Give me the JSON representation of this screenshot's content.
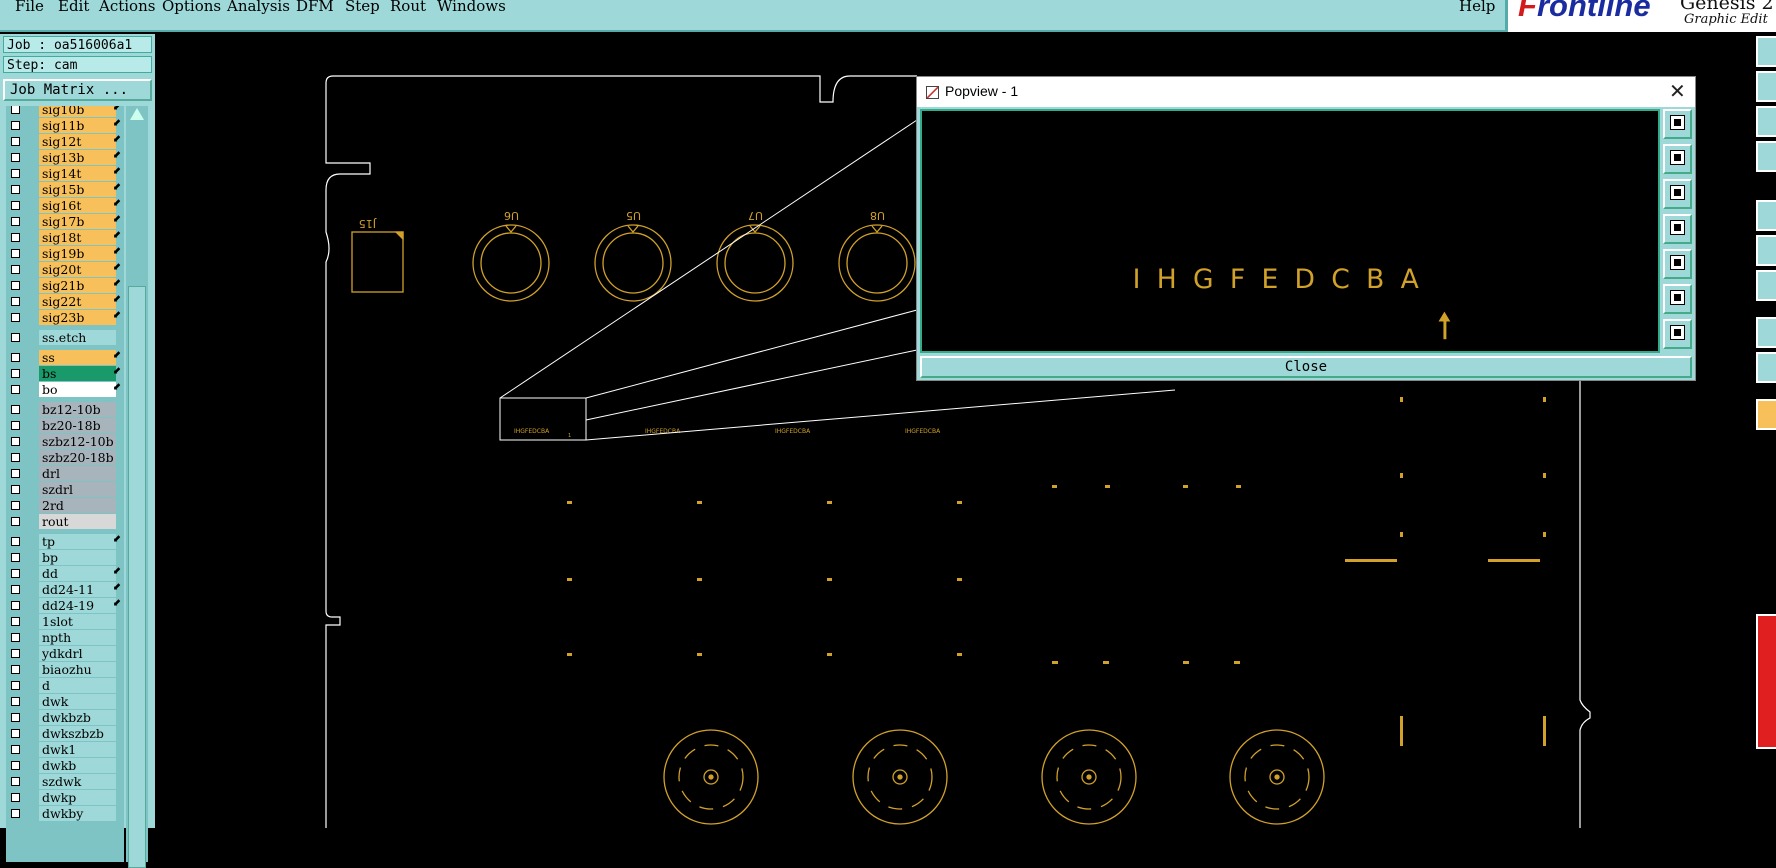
{
  "menubar": {
    "items": [
      "File",
      "Edit",
      "Actions",
      "Options",
      "Analysis",
      "DFM",
      "Step",
      "Rout",
      "Windows"
    ],
    "help": "Help"
  },
  "brand": {
    "logo_prefix": "F",
    "logo_rest": "rontline",
    "product": "Genesis 2",
    "subtitle": "Graphic Edit"
  },
  "job": {
    "job_label": "Job : oa516006a1",
    "step_label": "Step: cam",
    "matrix_button": "Job Matrix ..."
  },
  "layers": [
    {
      "name": "sig10b",
      "color": "#f8c05a",
      "flag": true
    },
    {
      "name": "sig11b",
      "color": "#f8c05a",
      "flag": true
    },
    {
      "name": "sig12t",
      "color": "#f8c05a",
      "flag": true
    },
    {
      "name": "sig13b",
      "color": "#f8c05a",
      "flag": true
    },
    {
      "name": "sig14t",
      "color": "#f8c05a",
      "flag": true
    },
    {
      "name": "sig15b",
      "color": "#f8c05a",
      "flag": true
    },
    {
      "name": "sig16t",
      "color": "#f8c05a",
      "flag": true
    },
    {
      "name": "sig17b",
      "color": "#f8c05a",
      "flag": true
    },
    {
      "name": "sig18t",
      "color": "#f8c05a",
      "flag": true
    },
    {
      "name": "sig19b",
      "color": "#f8c05a",
      "flag": true
    },
    {
      "name": "sig20t",
      "color": "#f8c05a",
      "flag": true
    },
    {
      "name": "sig21b",
      "color": "#f8c05a",
      "flag": true
    },
    {
      "name": "sig22t",
      "color": "#f8c05a",
      "flag": true
    },
    {
      "name": "sig23b",
      "color": "#f8c05a",
      "flag": true
    },
    {
      "name": "ss.etch",
      "color": "#9ed8d8",
      "flag": false,
      "gap": true
    },
    {
      "name": "ss",
      "color": "#f8c05a",
      "flag": true,
      "gap": true
    },
    {
      "name": "bs",
      "color": "#1a9a6a",
      "flag": true
    },
    {
      "name": "bo",
      "color": "#ffffff",
      "flag": true
    },
    {
      "name": "bz12-10b",
      "color": "#a8b4bc",
      "flag": false,
      "gap": true
    },
    {
      "name": "bz20-18b",
      "color": "#a8b4bc",
      "flag": false
    },
    {
      "name": "szbz12-10b",
      "color": "#a8b4bc",
      "flag": false
    },
    {
      "name": "szbz20-18b",
      "color": "#a8b4bc",
      "flag": false
    },
    {
      "name": "drl",
      "color": "#a8b4bc",
      "flag": false
    },
    {
      "name": "szdrl",
      "color": "#a8b4bc",
      "flag": false
    },
    {
      "name": "2rd",
      "color": "#a8b4bc",
      "flag": false
    },
    {
      "name": "rout",
      "color": "#d8d8d8",
      "flag": false
    },
    {
      "name": "tp",
      "color": "#9ed8d8",
      "flag": true,
      "gap": true
    },
    {
      "name": "bp",
      "color": "#9ed8d8",
      "flag": false
    },
    {
      "name": "dd",
      "color": "#9ed8d8",
      "flag": true
    },
    {
      "name": "dd24-11",
      "color": "#9ed8d8",
      "flag": true
    },
    {
      "name": "dd24-19",
      "color": "#9ed8d8",
      "flag": true
    },
    {
      "name": "1slot",
      "color": "#9ed8d8",
      "flag": false
    },
    {
      "name": "npth",
      "color": "#9ed8d8",
      "flag": false
    },
    {
      "name": "ydkdrl",
      "color": "#9ed8d8",
      "flag": false
    },
    {
      "name": "biaozhu",
      "color": "#9ed8d8",
      "flag": false
    },
    {
      "name": "d",
      "color": "#9ed8d8",
      "flag": false
    },
    {
      "name": "dwk",
      "color": "#9ed8d8",
      "flag": false
    },
    {
      "name": "dwkbzb",
      "color": "#9ed8d8",
      "flag": false
    },
    {
      "name": "dwkszbzb",
      "color": "#9ed8d8",
      "flag": false
    },
    {
      "name": "dwk1",
      "color": "#9ed8d8",
      "flag": false
    },
    {
      "name": "dwkb",
      "color": "#9ed8d8",
      "flag": false
    },
    {
      "name": "szdwk",
      "color": "#9ed8d8",
      "flag": false
    },
    {
      "name": "dwkp",
      "color": "#9ed8d8",
      "flag": false
    },
    {
      "name": "dwkby",
      "color": "#9ed8d8",
      "flag": false
    }
  ],
  "canvas": {
    "connector_labels": [
      "U6",
      "U5",
      "U7",
      "U8"
    ],
    "connector_main_label": "J15",
    "zoom_text": "IHGFEDCBA",
    "zoom_index": "1"
  },
  "popview": {
    "title": "Popview - 1",
    "close_x": "✕",
    "zoom_text": "I H G F E D C B A",
    "close_button": "Close"
  },
  "colors": {
    "panel": "#9ed8d8",
    "outline": "#ffffff",
    "feature": "#d1a12a"
  },
  "icons": {
    "popview_tools": [
      "zoom-home-icon",
      "zoom-in-icon",
      "zoom-out-icon",
      "pan-left-icon",
      "pan-right-icon",
      "fit-icon",
      "center-icon"
    ]
  }
}
